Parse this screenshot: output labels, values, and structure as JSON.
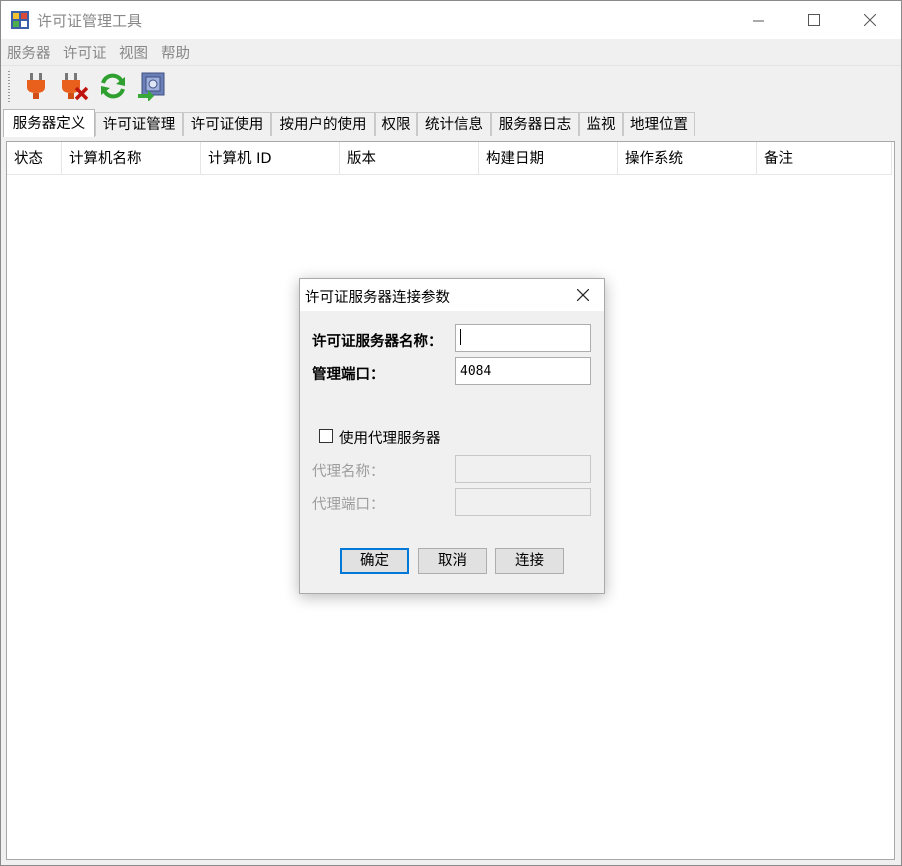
{
  "window": {
    "title": "许可证管理工具"
  },
  "menu": [
    "服务器",
    "许可证",
    "视图",
    "帮助"
  ],
  "toolbar": {
    "icons": [
      "connect-plug-icon",
      "disconnect-plug-icon",
      "refresh-icon",
      "server-config-icon"
    ]
  },
  "tabs": [
    {
      "label": "服务器定义",
      "active": true
    },
    {
      "label": "许可证管理"
    },
    {
      "label": "许可证使用"
    },
    {
      "label": "按用户的使用"
    },
    {
      "label": "权限"
    },
    {
      "label": "统计信息"
    },
    {
      "label": "服务器日志"
    },
    {
      "label": "监视"
    },
    {
      "label": "地理位置"
    }
  ],
  "table": {
    "columns": [
      "状态",
      "计算机名称",
      "计算机 ID",
      "版本",
      "构建日期",
      "操作系统",
      "备注"
    ],
    "rows": []
  },
  "dialog": {
    "title": "许可证服务器连接参数",
    "server_name_label": "许可证服务器名称：",
    "server_name_value": "",
    "port_label": "管理端口：",
    "port_value": "4084",
    "proxy_checkbox_label": "使用代理服务器",
    "proxy_checked": false,
    "proxy_name_label": "代理名称：",
    "proxy_port_label": "代理端口：",
    "ok_label": "确定",
    "cancel_label": "取消",
    "connect_label": "连接"
  },
  "colors": {
    "accent": "#0078d7",
    "disabled_text": "#9d9d9d"
  }
}
